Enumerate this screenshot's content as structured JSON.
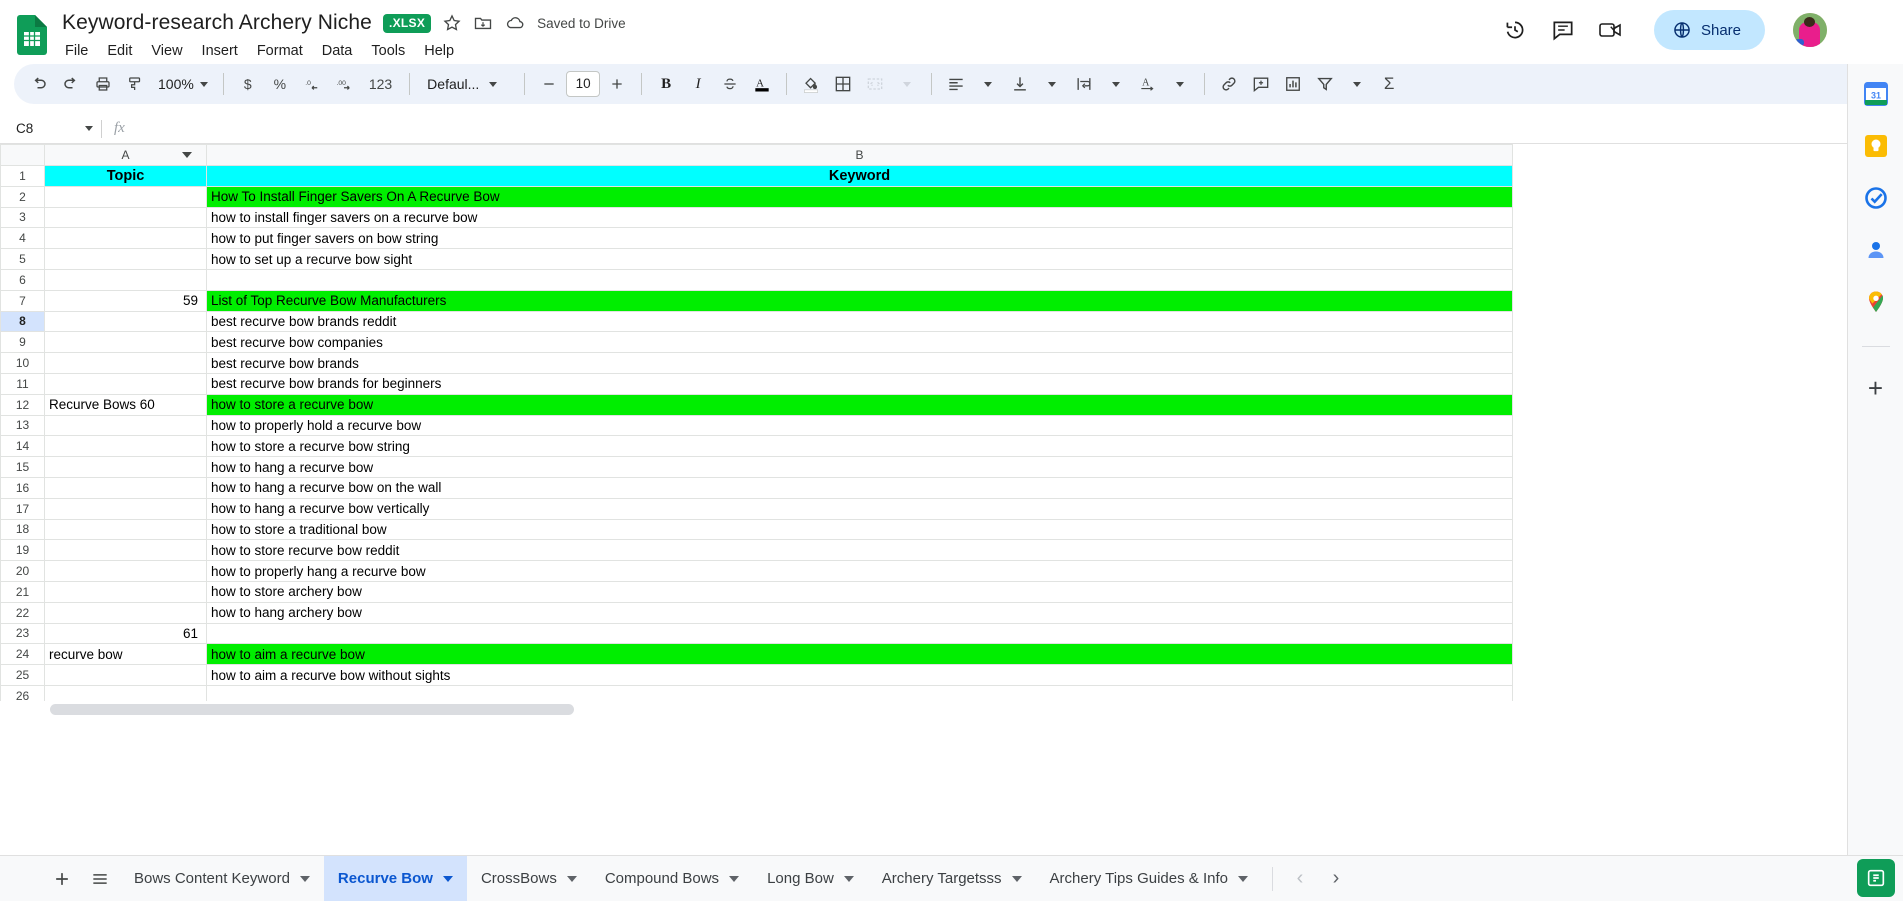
{
  "app": {
    "doc_title": "Keyword-research Archery Niche",
    "file_badge": ".XLSX",
    "save_status": "Saved to Drive",
    "menus": [
      "File",
      "Edit",
      "View",
      "Insert",
      "Format",
      "Data",
      "Tools",
      "Help"
    ],
    "share_label": "Share"
  },
  "toolbar": {
    "zoom": "100%",
    "number_123": "123",
    "font_family": "Defaul...",
    "font_size": "10",
    "currency": "$",
    "percent": "%",
    "decimal_decrease": ".0",
    "decimal_increase": ".00",
    "bold": "B",
    "italic": "I",
    "sigma": "Σ"
  },
  "formula_bar": {
    "name_box": "C8",
    "formula_value": "",
    "fx_label": "fx"
  },
  "grid": {
    "columns": [
      "A",
      "B"
    ],
    "rows": [
      {
        "num": "1",
        "a": "Topic",
        "b": "Keyword",
        "style": "cyan",
        "active": false
      },
      {
        "num": "2",
        "a": "",
        "b": "How To Install Finger Savers On A Recurve Bow",
        "style": "green",
        "active": false
      },
      {
        "num": "3",
        "a": "",
        "b": "how to install finger savers on a recurve bow",
        "style": "",
        "active": false
      },
      {
        "num": "4",
        "a": "",
        "b": "how to put finger savers on bow string",
        "style": "",
        "active": false
      },
      {
        "num": "5",
        "a": "",
        "b": "how to set up a recurve bow sight",
        "style": "",
        "active": false
      },
      {
        "num": "6",
        "a": "",
        "b": "",
        "style": "",
        "active": false
      },
      {
        "num": "7",
        "a": "59",
        "b": "List of Top Recurve Bow Manufacturers",
        "style": "green",
        "a_num": true,
        "active": false
      },
      {
        "num": "8",
        "a": "",
        "b": "best recurve bow brands reddit",
        "style": "",
        "active": true
      },
      {
        "num": "9",
        "a": "",
        "b": "best recurve bow companies",
        "style": "",
        "active": false
      },
      {
        "num": "10",
        "a": "",
        "b": "best recurve bow brands",
        "style": "",
        "active": false
      },
      {
        "num": "11",
        "a": "",
        "b": "best recurve bow brands for beginners",
        "style": "",
        "active": false
      },
      {
        "num": "12",
        "a": "Recurve Bows 60",
        "b": "how to store a recurve bow",
        "style": "green",
        "active": false
      },
      {
        "num": "13",
        "a": "",
        "b": "how to properly hold a recurve bow",
        "style": "",
        "active": false
      },
      {
        "num": "14",
        "a": "",
        "b": "how to store a recurve bow string",
        "style": "",
        "active": false
      },
      {
        "num": "15",
        "a": "",
        "b": "how to hang a recurve bow",
        "style": "",
        "active": false
      },
      {
        "num": "16",
        "a": "",
        "b": "how to hang a recurve bow on the wall",
        "style": "",
        "active": false
      },
      {
        "num": "17",
        "a": "",
        "b": "how to hang a recurve bow vertically",
        "style": "",
        "active": false
      },
      {
        "num": "18",
        "a": "",
        "b": "how to store a traditional bow",
        "style": "",
        "active": false
      },
      {
        "num": "19",
        "a": "",
        "b": "how to store recurve bow reddit",
        "style": "",
        "active": false
      },
      {
        "num": "20",
        "a": "",
        "b": "how to properly hang a recurve bow",
        "style": "",
        "active": false
      },
      {
        "num": "21",
        "a": "",
        "b": "how to store archery bow",
        "style": "",
        "active": false
      },
      {
        "num": "22",
        "a": "",
        "b": "how to hang archery bow",
        "style": "",
        "active": false
      },
      {
        "num": "23",
        "a": "61",
        "b": "",
        "style": "",
        "a_num": true,
        "active": false
      },
      {
        "num": "24",
        "a": "recurve bow",
        "b": "how to aim a recurve bow",
        "style": "green",
        "active": false
      },
      {
        "num": "25",
        "a": "",
        "b": "how to aim a recurve bow without sights",
        "style": "",
        "active": false
      },
      {
        "num": "26",
        "a": "",
        "b": "",
        "style": "",
        "active": false
      }
    ]
  },
  "sheet_tabs": {
    "tabs": [
      {
        "label": "Bows Content Keyword",
        "active": false
      },
      {
        "label": "Recurve Bow",
        "active": true
      },
      {
        "label": "CrossBows",
        "active": false
      },
      {
        "label": "Compound Bows",
        "active": false
      },
      {
        "label": "Long Bow",
        "active": false
      },
      {
        "label": "Archery Targetsss",
        "active": false
      },
      {
        "label": "Archery Tips Guides & Info",
        "active": false
      }
    ]
  },
  "colors": {
    "accent_blue": "#0b57d0",
    "share_bg": "#c2e7ff",
    "header_cyan": "#00ffff",
    "highlight_green": "#00ee00",
    "active_row": "#d3e3fd",
    "toolbar_bg": "#edf2fa",
    "sheets_green": "#0f9d58"
  }
}
